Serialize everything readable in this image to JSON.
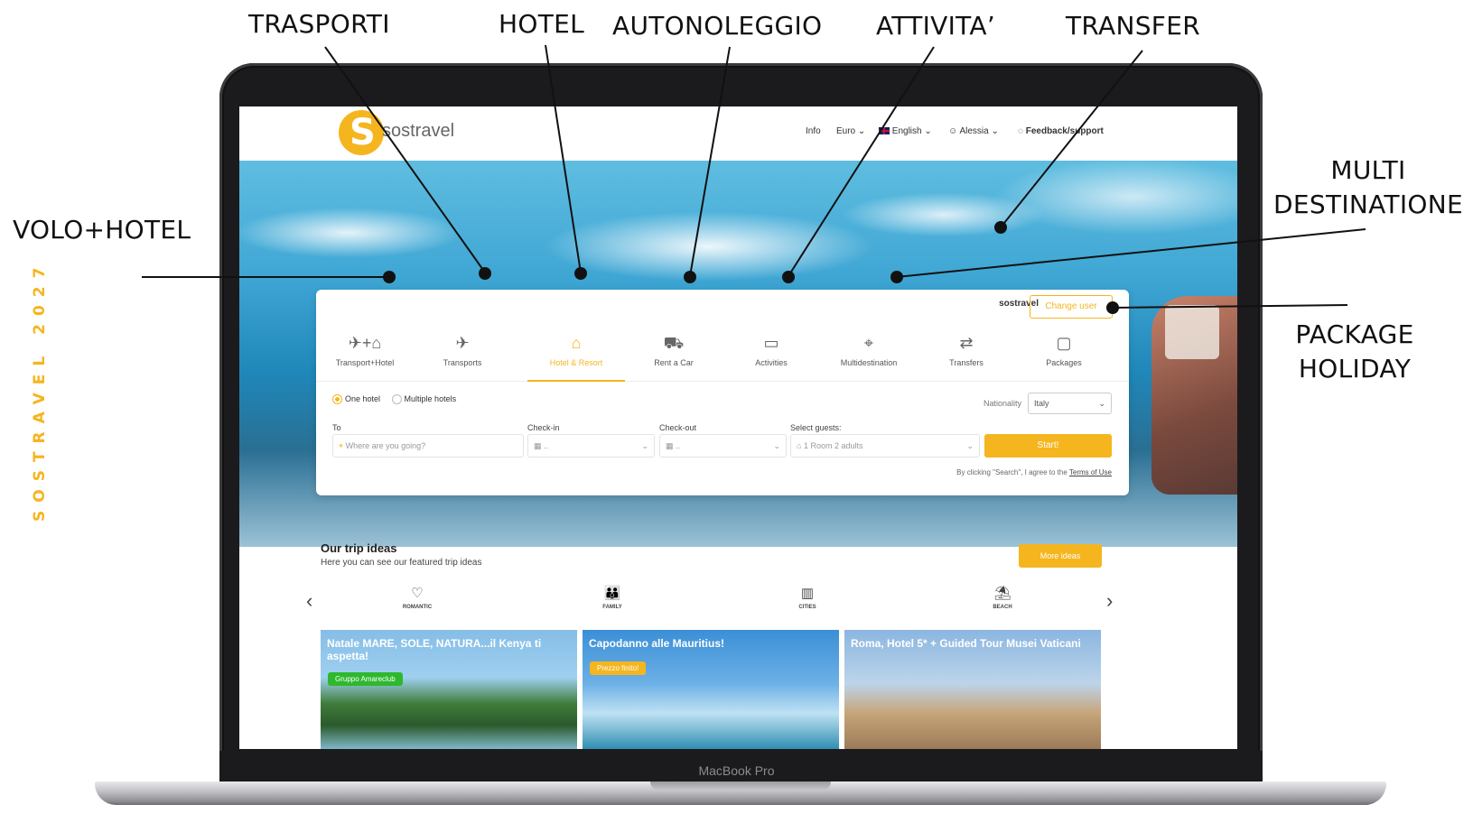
{
  "annotations": {
    "trasporti": "TRASPORTI",
    "hotel": "HOTEL",
    "autonoleggio": "AUTONOLEGGIO",
    "attivita": "ATTIVITA’",
    "transfer": "TRANSFER",
    "multi_line1": "MULTI",
    "multi_line2": "DESTINATIONE",
    "volo_hotel": "VOLO+HOTEL",
    "package_line1": "PACKAGE",
    "package_line2": "HOLIDAY",
    "side_brand": "SOSTRAVEL 2027"
  },
  "laptop": {
    "model_label": "MacBook Pro"
  },
  "site": {
    "logo_text": "sostravel",
    "nav": {
      "info": "Info",
      "currency": "Euro ⌄",
      "language": "English ⌄",
      "user": "Alessia ⌄",
      "feedback": "Feedback/support"
    }
  },
  "search": {
    "panel_user": "sostravel",
    "change_user": "Change user",
    "tabs": [
      {
        "label": "Transport+Hotel",
        "icon": "plane-bed-icon",
        "glyph": "✈+⌂"
      },
      {
        "label": "Transports",
        "icon": "plane-icon",
        "glyph": "✈"
      },
      {
        "label": "Hotel & Resort",
        "icon": "bed-icon",
        "glyph": "⌂"
      },
      {
        "label": "Rent a Car",
        "icon": "car-icon",
        "glyph": "⛟"
      },
      {
        "label": "Activities",
        "icon": "ticket-icon",
        "glyph": "▭"
      },
      {
        "label": "Multidestination",
        "icon": "pin-icon",
        "glyph": "⌖"
      },
      {
        "label": "Transfers",
        "icon": "swap-icon",
        "glyph": "⇄"
      },
      {
        "label": "Packages",
        "icon": "bag-icon",
        "glyph": "▢"
      }
    ],
    "active_tab": "Hotel & Resort",
    "radio_one": "One hotel",
    "radio_multiple": "Multiple hotels",
    "nationality_label": "Nationality",
    "nationality_value": "Italy",
    "to_label": "To",
    "to_placeholder": "Where are you going?",
    "checkin_label": "Check-in",
    "checkin_value": "..",
    "checkout_label": "Check-out",
    "checkout_value": "..",
    "guests_label": "Select guests:",
    "guests_value": "1 Room 2 adults",
    "start_button": "Start!",
    "terms_prefix": "By clicking \"Search\", I agree to the",
    "terms_link": "Terms of Use"
  },
  "ideas": {
    "title": "Our trip ideas",
    "subtitle": "Here you can see our featured trip ideas",
    "more_button": "More ideas",
    "categories": [
      {
        "label": "ROMANTIC",
        "icon": "heart-icon",
        "glyph": "♡"
      },
      {
        "label": "FAMILY",
        "icon": "family-icon",
        "glyph": "👪"
      },
      {
        "label": "CITIES",
        "icon": "city-icon",
        "glyph": "▥"
      },
      {
        "label": "BEACH",
        "icon": "umbrella-icon",
        "glyph": "⛱"
      }
    ],
    "cards": [
      {
        "title": "Natale MARE, SOLE, NATURA...il Kenya ti aspetta!",
        "tag": "Gruppo Amareclub",
        "tag_color": "#2eb82e"
      },
      {
        "title": "Capodanno alle Mauritius!",
        "tag": "Prezzo finito!",
        "tag_color": "#f5b51e"
      },
      {
        "title": "Roma, Hotel 5* + Guided Tour Musei Vaticani",
        "tag": "",
        "tag_color": ""
      }
    ]
  }
}
